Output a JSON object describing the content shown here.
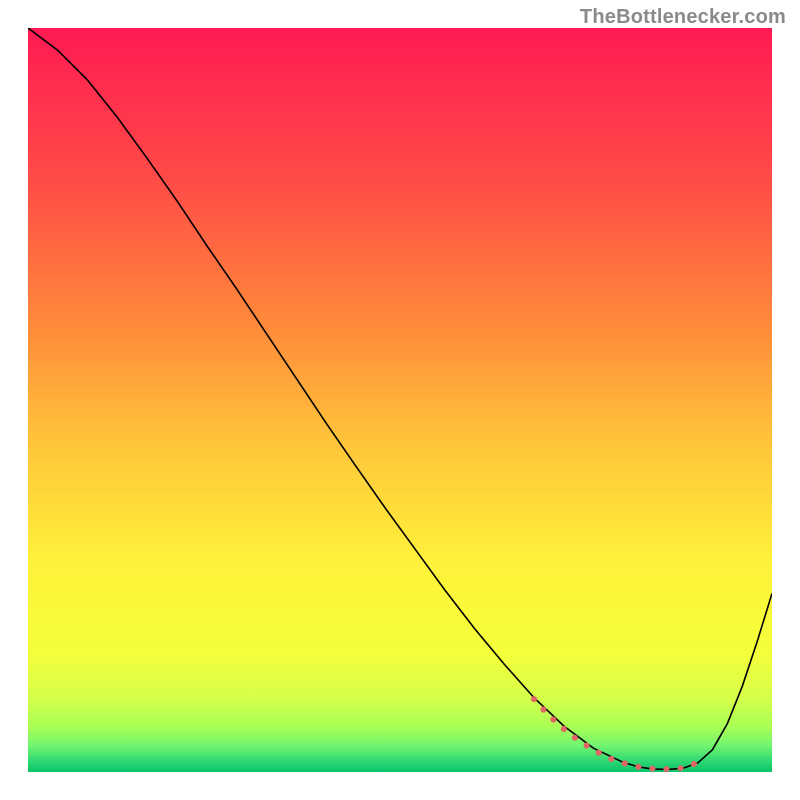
{
  "attribution": "TheBottlenecker.com",
  "chart_data": {
    "type": "line",
    "title": "",
    "xlabel": "",
    "ylabel": "",
    "xlim": [
      0,
      100
    ],
    "ylim": [
      0,
      100
    ],
    "grid": false,
    "note": "No axis ticks or numeric labels are rendered in the image; values below are in percent-of-axis coordinates (origin bottom-left).",
    "series": [
      {
        "name": "curve",
        "color": "#000000",
        "width": 1.6,
        "x": [
          0,
          4,
          8,
          12,
          16,
          20,
          24,
          28,
          32,
          36,
          40,
          44,
          48,
          52,
          56,
          60,
          64,
          68,
          72,
          76,
          80,
          82,
          84,
          86,
          88,
          90,
          92,
          94,
          96,
          98,
          100
        ],
        "y": [
          100,
          97,
          93,
          88,
          82.5,
          76.8,
          70.8,
          65,
          59,
          53,
          47,
          41.2,
          35.5,
          30,
          24.5,
          19.3,
          14.5,
          10,
          6.2,
          3.2,
          1.3,
          0.7,
          0.4,
          0.35,
          0.5,
          1.2,
          3.0,
          6.5,
          11.5,
          17.5,
          24
        ]
      },
      {
        "name": "optimal-range-marker",
        "type": "marker",
        "color": "#e06666",
        "width": 6,
        "x": [
          68,
          70,
          72,
          74,
          76,
          78,
          80,
          82,
          83,
          84,
          85,
          86,
          87,
          88,
          89,
          90
        ],
        "y": [
          9.8,
          7.6,
          5.8,
          4.2,
          3.0,
          1.9,
          1.2,
          0.7,
          0.55,
          0.45,
          0.4,
          0.38,
          0.42,
          0.55,
          0.85,
          1.3
        ]
      }
    ],
    "background_gradient_stops": [
      {
        "offset": 0.0,
        "color": "#ff1a53"
      },
      {
        "offset": 0.2,
        "color": "#ff4a47"
      },
      {
        "offset": 0.4,
        "color": "#ff8a3a"
      },
      {
        "offset": 0.55,
        "color": "#ffc23a"
      },
      {
        "offset": 0.72,
        "color": "#fff23a"
      },
      {
        "offset": 0.84,
        "color": "#f4ff3a"
      },
      {
        "offset": 0.9,
        "color": "#d6ff4a"
      },
      {
        "offset": 0.94,
        "color": "#a8ff55"
      },
      {
        "offset": 0.965,
        "color": "#70f570"
      },
      {
        "offset": 0.985,
        "color": "#2fd873"
      },
      {
        "offset": 1.0,
        "color": "#08c46a"
      }
    ]
  }
}
